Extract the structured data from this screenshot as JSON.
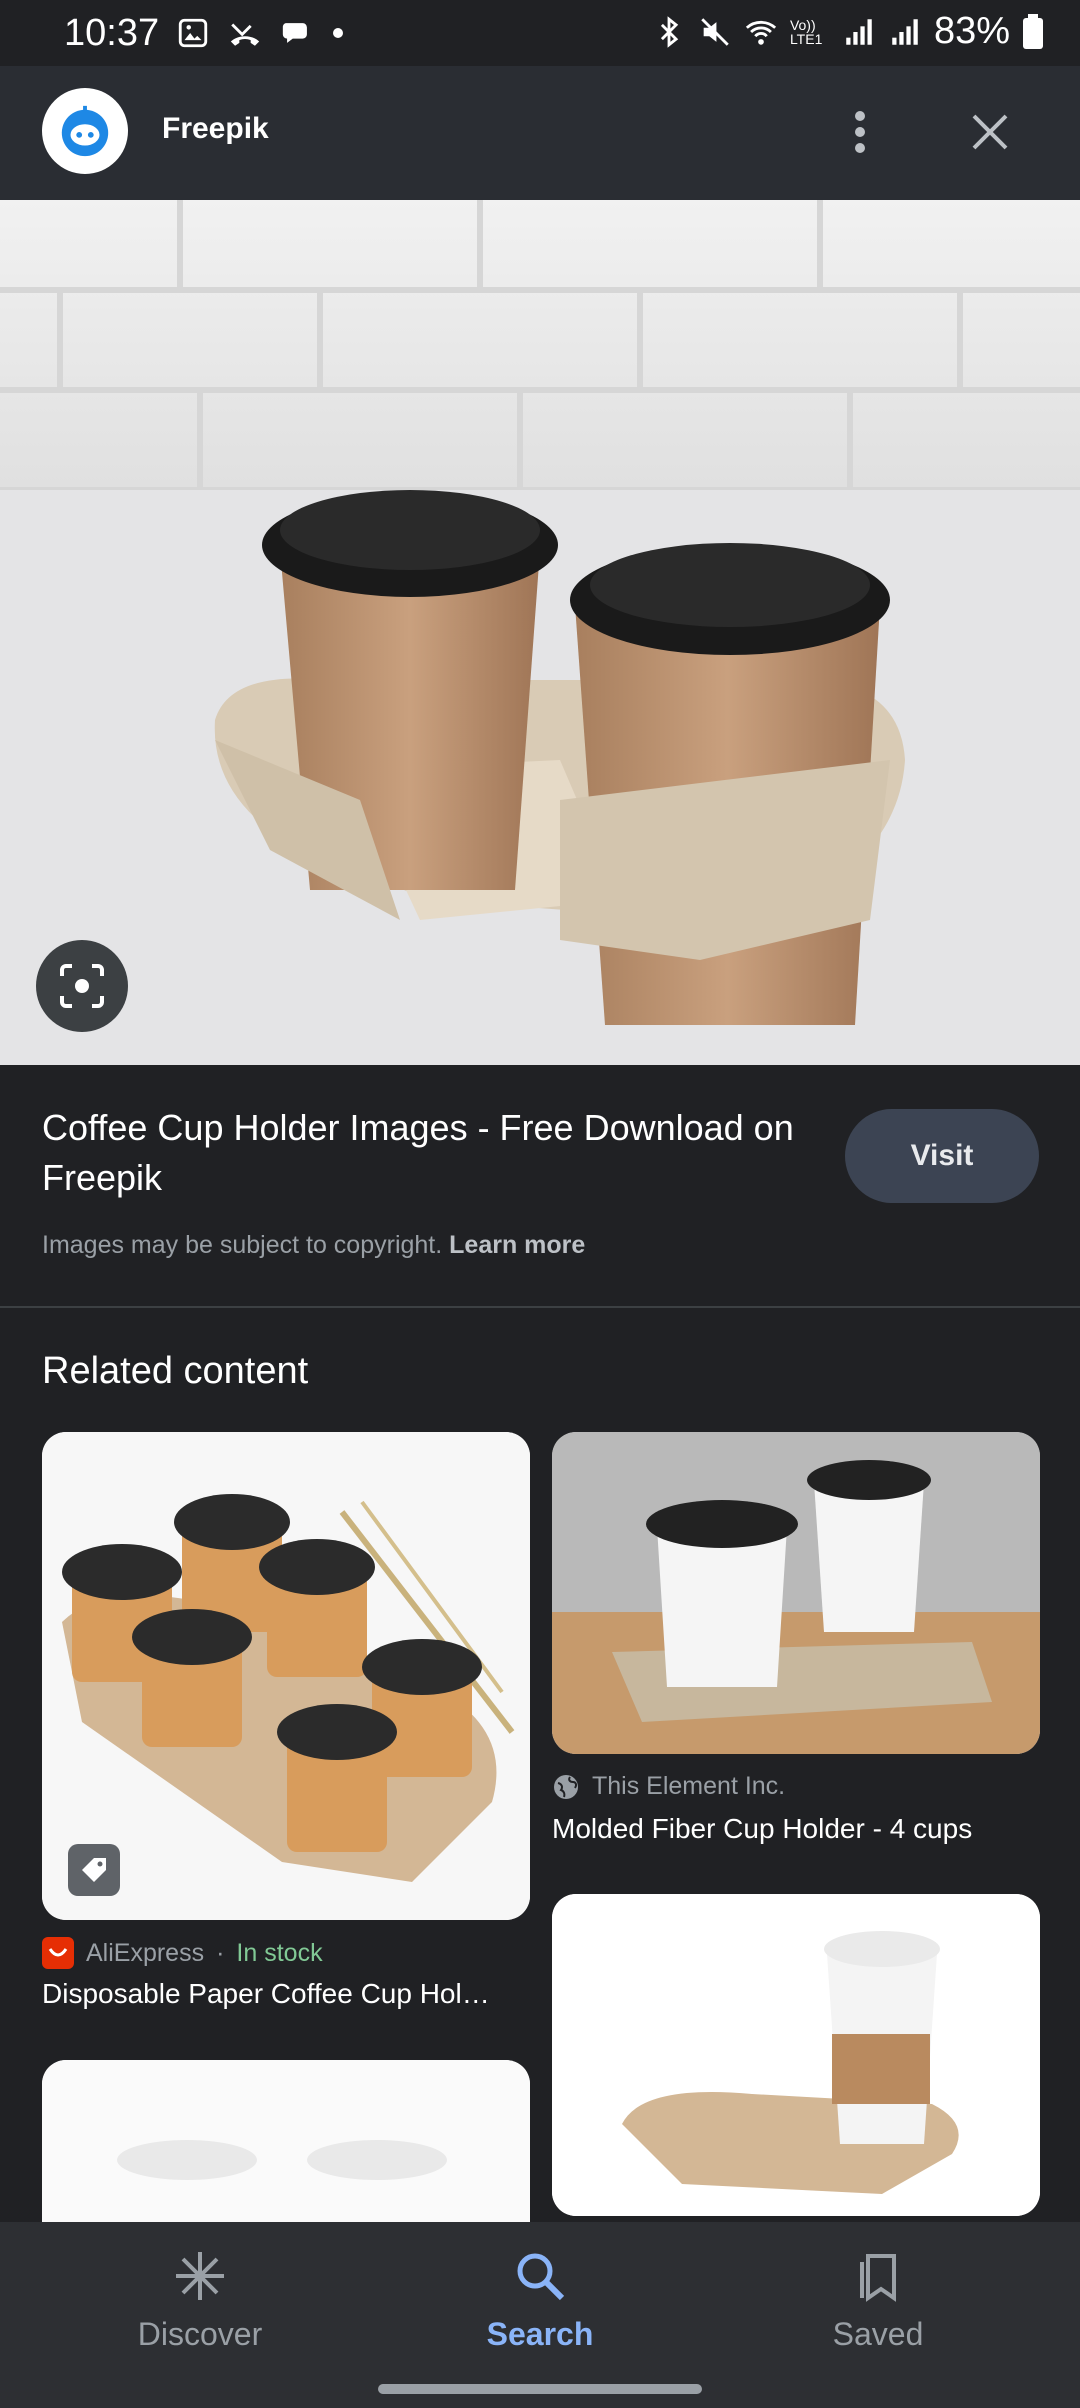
{
  "status_bar": {
    "time": "10:37",
    "battery": "83%",
    "left_icons": [
      "gallery-icon",
      "missed-call-icon",
      "chat-icon",
      "dot-icon"
    ],
    "right_icons": [
      "bluetooth-icon",
      "mute-icon",
      "wifi-icon",
      "volte-icon",
      "signal-icon",
      "signal-icon",
      "battery-icon"
    ],
    "volte_text": "Vo)) LTE1"
  },
  "appbar": {
    "title": "Freepik",
    "more_icon": "more-vert-icon",
    "close_icon": "close-icon"
  },
  "hero": {
    "lens_icon": "lens-icon"
  },
  "info": {
    "title": "Coffee Cup Holder Images - Free Download on Freepik",
    "visit_label": "Visit",
    "copyright_text": "Images may be subject to copyright.",
    "learn_more": "Learn more"
  },
  "related": {
    "heading": "Related content",
    "cards": [
      {
        "source": "AliExpress",
        "separator": "·",
        "stock": "In stock",
        "title": "Disposable Paper Coffee Cup Hol…"
      },
      {
        "source": "This Element Inc.",
        "title": "Molded Fiber Cup Holder - 4 cups"
      }
    ]
  },
  "bottom_nav": {
    "items": [
      {
        "label": "Discover",
        "icon": "asterisk-icon"
      },
      {
        "label": "Search",
        "icon": "search-icon"
      },
      {
        "label": "Saved",
        "icon": "bookmarks-icon"
      }
    ],
    "active": "Search"
  },
  "colors": {
    "background": "#202124",
    "accent": "#8ab4f8",
    "in_stock": "#81c995",
    "visit_button": "#3c4453"
  }
}
